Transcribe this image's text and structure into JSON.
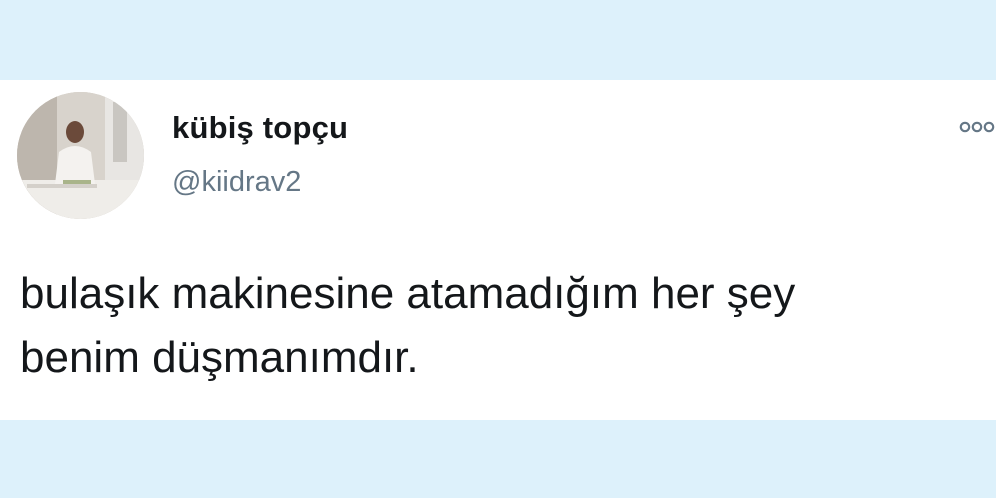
{
  "tweet": {
    "author": {
      "display_name": "kübiş topçu",
      "handle": "@kiidrav2",
      "avatar_icon": "user-photo-avatar"
    },
    "more_icon": "more-dots-icon",
    "text_lines": [
      "bulaşık makinesine atamadığım her şey",
      "benim düşmanımdır."
    ]
  },
  "colors": {
    "background": "#ddf1fb",
    "card": "#ffffff",
    "text_primary": "#14171a",
    "text_secondary": "#657786"
  }
}
